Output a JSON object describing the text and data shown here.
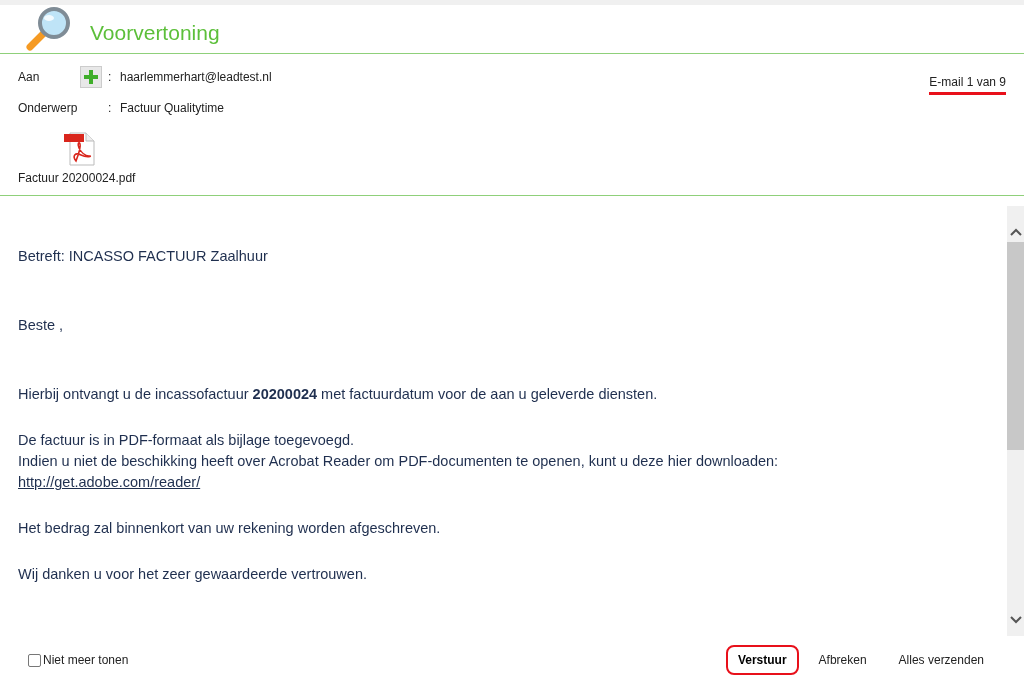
{
  "title": "Voorvertoning",
  "fields": [
    {
      "label": "Aan",
      "add_button": true,
      "separator": ":",
      "value": "haarlemmerhart@leadtest.nl"
    },
    {
      "label": "Onderwerp",
      "add_button": false,
      "separator": ":",
      "value": "Factuur Qualitytime"
    }
  ],
  "counter": {
    "text": "E-mail 1 van 9",
    "highlighted": true
  },
  "attachment": {
    "name": "Factuur 20200024.pdf"
  },
  "body": [
    {
      "lines": [
        {
          "kind": "text",
          "text": "Betreft: INCASSO FACTUUR Zaalhuur"
        }
      ]
    },
    {
      "lines": [
        {
          "kind": "text",
          "text": "Beste ,"
        }
      ]
    },
    {
      "lines": [
        {
          "kind": "text",
          "text": "Hierbij ontvangt u de incassofactuur **20200024** met factuurdatum voor de aan u geleverde diensten."
        }
      ]
    },
    {
      "lines": [
        {
          "kind": "text",
          "text": "De factuur is in PDF-formaat als bijlage toegevoegd."
        },
        {
          "kind": "text",
          "text": "Indien u niet de beschikking heeft over Acrobat Reader om PDF-documenten te openen, kunt u deze hier downloaden:"
        },
        {
          "kind": "link",
          "text": "http://get.adobe.com/reader/"
        }
      ]
    },
    {
      "lines": [
        {
          "kind": "text",
          "text": "Het bedrag zal binnenkort van uw rekening worden afgeschreven."
        }
      ]
    },
    {
      "lines": [
        {
          "kind": "text",
          "text": "Wij danken u voor het zeer gewaardeerde vertrouwen."
        }
      ]
    }
  ],
  "dont_show_again": {
    "label": "Niet meer tonen",
    "checked": false
  },
  "buttons": [
    {
      "label": "Verstuur",
      "primary": true,
      "highlighted": true
    },
    {
      "label": "Afbreken",
      "primary": false,
      "highlighted": false
    },
    {
      "label": "Alles verzenden",
      "primary": false,
      "highlighted": false
    }
  ]
}
